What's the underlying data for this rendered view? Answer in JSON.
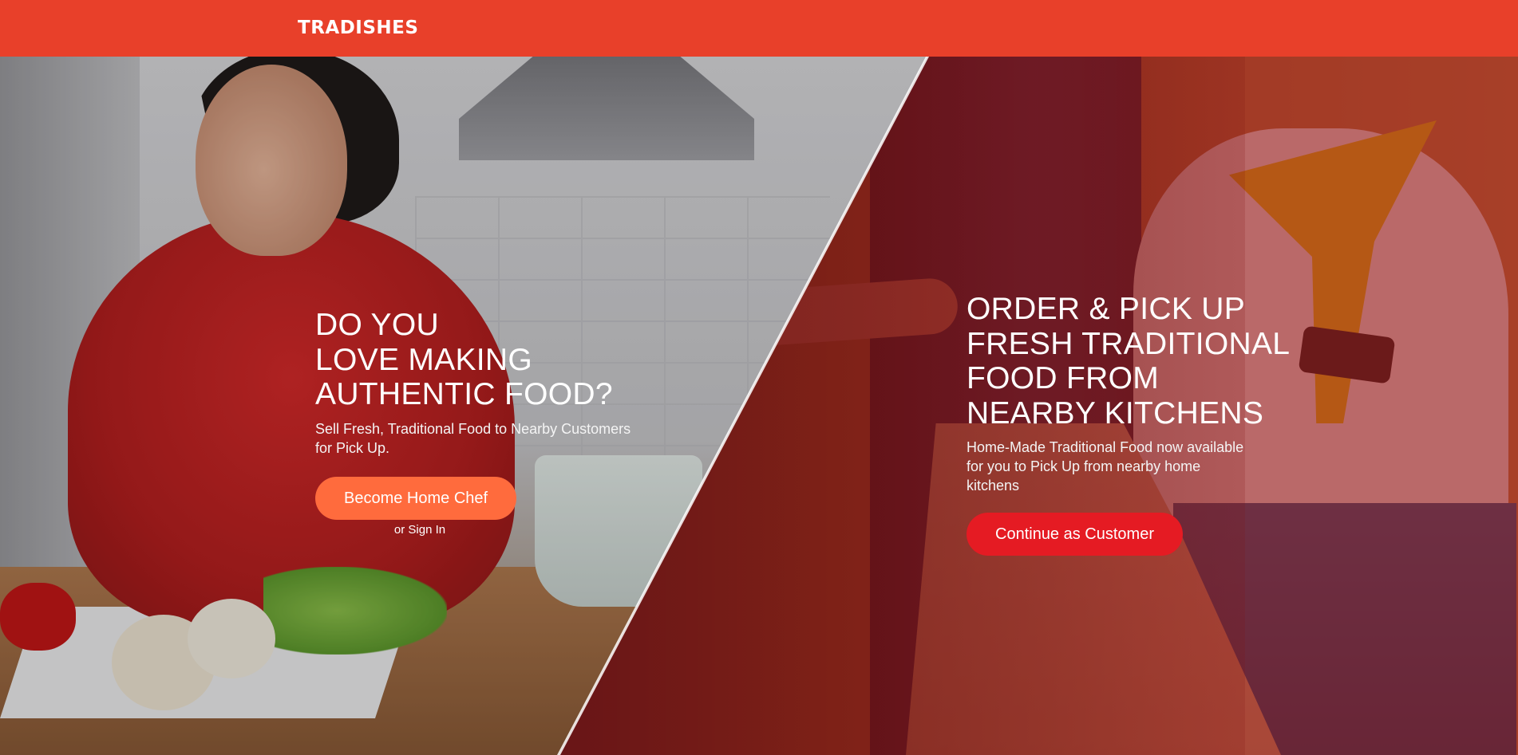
{
  "header": {
    "logo_text": "TRADISHES",
    "background_color": "#e8402a"
  },
  "left_panel": {
    "headline_lines": [
      "DO YOU",
      "LOVE MAKING",
      "AUTHENTIC FOOD?"
    ],
    "subcopy": "Sell Fresh, Traditional Food to Nearby Customers for Pick Up.",
    "cta_label": "Become Home Chef",
    "cta_color": "#ff6b3d",
    "signin_label": "or Sign In"
  },
  "right_panel": {
    "headline_lines": [
      "ORDER & PICK UP",
      "FRESH TRADITIONAL",
      "FOOD FROM",
      "NEARBY KITCHENS"
    ],
    "subcopy": "Home-Made Traditional Food now available for you to Pick Up from nearby home kitchens",
    "cta_label": "Continue as Customer",
    "cta_color": "#e51b23",
    "overlay_color": "#961414"
  }
}
